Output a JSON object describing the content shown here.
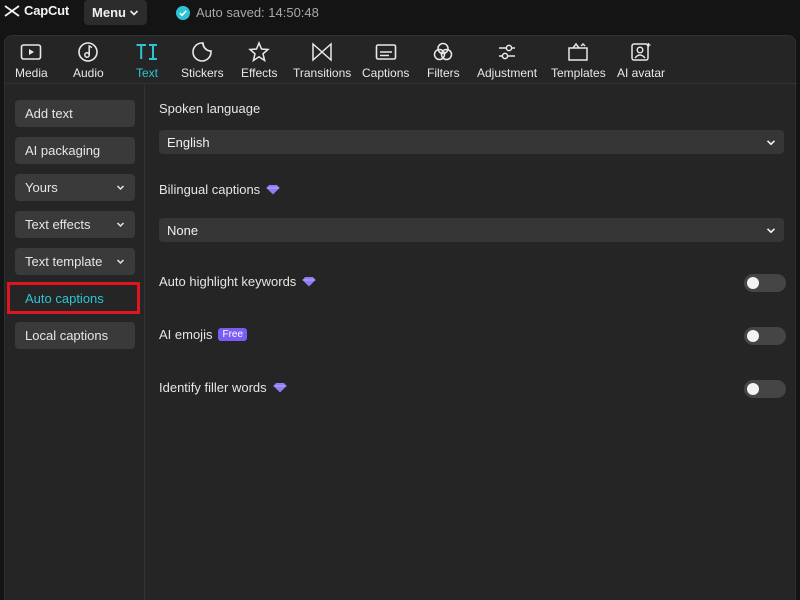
{
  "app": {
    "logo_text": "CapCut",
    "menu_label": "Menu",
    "autosave_text": "Auto saved: 14:50:48"
  },
  "colors": {
    "accent": "#2ec4d6",
    "premium": "#8f7cf7",
    "highlight": "#e0151f"
  },
  "toolbar": {
    "tools": [
      {
        "label": "Media",
        "icon": "media-icon"
      },
      {
        "label": "Audio",
        "icon": "audio-icon"
      },
      {
        "label": "Text",
        "icon": "text-icon",
        "active": true
      },
      {
        "label": "Stickers",
        "icon": "stickers-icon"
      },
      {
        "label": "Effects",
        "icon": "effects-icon"
      },
      {
        "label": "Transitions",
        "icon": "transitions-icon"
      },
      {
        "label": "Captions",
        "icon": "captions-icon"
      },
      {
        "label": "Filters",
        "icon": "filters-icon"
      },
      {
        "label": "Adjustment",
        "icon": "adjustment-icon"
      },
      {
        "label": "Templates",
        "icon": "templates-icon"
      },
      {
        "label": "AI avatar",
        "icon": "ai-avatar-icon"
      }
    ]
  },
  "sidebar": {
    "items": [
      {
        "label": "Add text"
      },
      {
        "label": "AI packaging"
      },
      {
        "label": "Yours",
        "has_chevron": true
      },
      {
        "label": "Text effects",
        "has_chevron": true
      },
      {
        "label": "Text template",
        "has_chevron": true
      },
      {
        "label": "Auto captions",
        "active": true
      },
      {
        "label": "Local captions"
      }
    ]
  },
  "captions_panel": {
    "spoken_language": {
      "label": "Spoken language",
      "value": "English"
    },
    "bilingual_captions": {
      "label": "Bilingual captions",
      "value": "None",
      "premium": true
    },
    "auto_highlight": {
      "label": "Auto highlight keywords",
      "premium": true,
      "enabled": false
    },
    "ai_emojis": {
      "label": "AI emojis",
      "badge": "Free",
      "enabled": false
    },
    "filler_words": {
      "label": "Identify filler words",
      "premium": true,
      "enabled": false
    }
  }
}
